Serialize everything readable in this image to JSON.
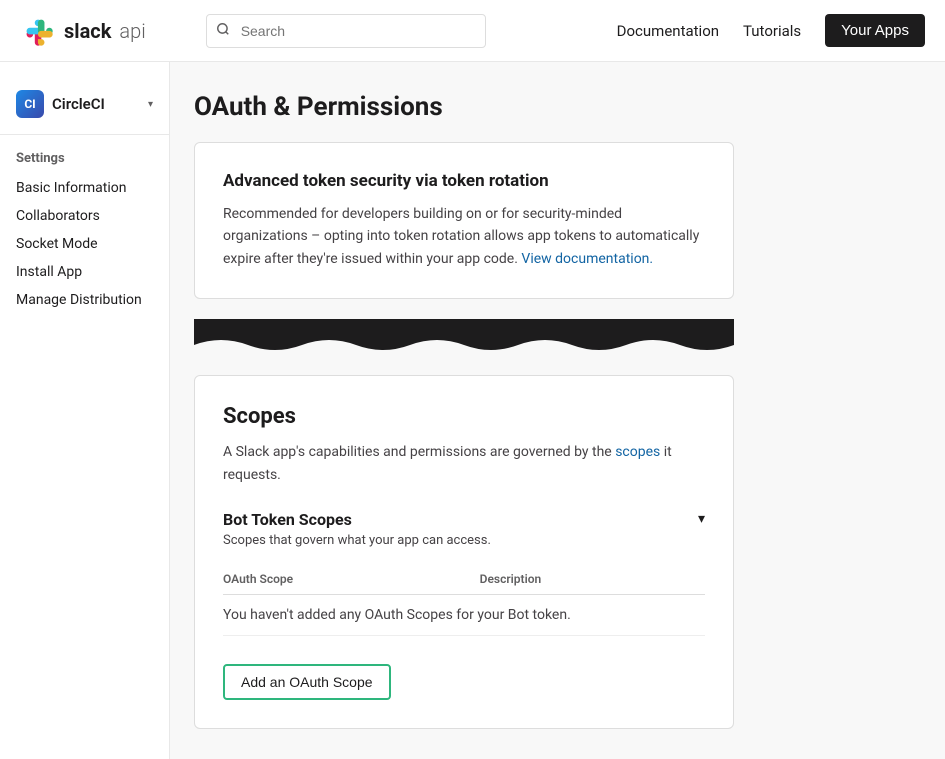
{
  "header": {
    "logo_text": "slack",
    "logo_api": "api",
    "search_placeholder": "Search",
    "nav": {
      "documentation": "Documentation",
      "tutorials": "Tutorials",
      "your_apps": "Your Apps"
    }
  },
  "sidebar": {
    "app_name": "CircleCI",
    "settings_label": "Settings",
    "items": [
      {
        "id": "basic-information",
        "label": "Basic Information",
        "active": false
      },
      {
        "id": "collaborators",
        "label": "Collaborators",
        "active": false
      },
      {
        "id": "socket-mode",
        "label": "Socket Mode",
        "active": false
      },
      {
        "id": "install-app",
        "label": "Install App",
        "active": false
      },
      {
        "id": "manage-distribution",
        "label": "Manage Distribution",
        "active": false
      }
    ]
  },
  "page": {
    "title": "OAuth & Permissions"
  },
  "token_security": {
    "title": "Advanced token security via token rotation",
    "body": "Recommended for developers building on or for security-minded organizations – opting into token rotation allows app tokens to automatically expire after they're issued within your app code.",
    "link_text": "View documentation.",
    "link_url": "#"
  },
  "scopes": {
    "title": "Scopes",
    "description_before_link": "A Slack app's capabilities and permissions are governed by the",
    "link_text": "scopes",
    "description_after_link": "it requests.",
    "bot_token": {
      "title": "Bot Token Scopes",
      "subtitle": "Scopes that govern what your app can access.",
      "table_headers": {
        "scope": "OAuth Scope",
        "description": "Description"
      },
      "empty_message": "You haven't added any OAuth Scopes for your Bot token.",
      "add_button": "Add an OAuth Scope"
    }
  },
  "icons": {
    "search": "🔍",
    "chevron_down": "▾",
    "chevron_dropdown": "▾"
  },
  "colors": {
    "green_border": "#2eb67d",
    "link_blue": "#1264a3",
    "dark_bg": "#1d1c1d"
  }
}
